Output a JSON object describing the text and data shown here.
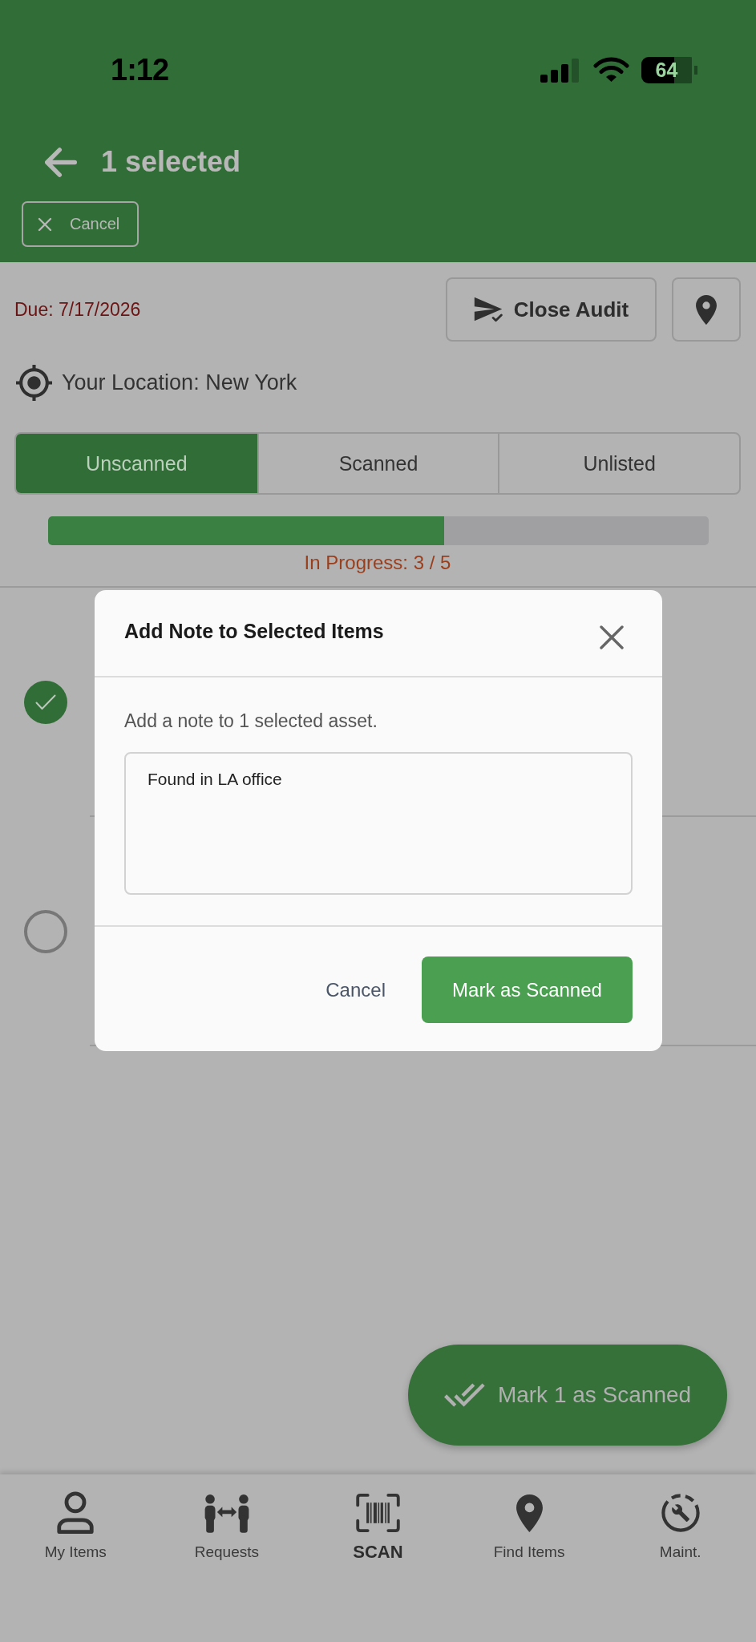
{
  "status_bar": {
    "time": "1:12",
    "battery": "64"
  },
  "header": {
    "title": "1 selected",
    "cancel_button": "Cancel"
  },
  "audit": {
    "due": "Due: 7/17/2026",
    "close_button": "Close Audit",
    "location": "Your Location: New York"
  },
  "tabs": [
    {
      "label": "Unscanned",
      "selected": true
    },
    {
      "label": "Scanned",
      "selected": false
    },
    {
      "label": "Unlisted",
      "selected": false
    }
  ],
  "progress": {
    "level": 0.6,
    "label": "In Progress: 3 / 5"
  },
  "items": [
    {
      "selected": true
    },
    {
      "selected": false
    }
  ],
  "dialog": {
    "title": "Add Note to Selected Items",
    "message": "Add a note to 1 selected asset.",
    "note": {
      "value": "Found in LA office"
    },
    "buttons": [
      {
        "label": "Cancel",
        "kind": "text"
      },
      {
        "label": "Mark as Scanned",
        "kind": "primary"
      }
    ]
  },
  "fab": {
    "label": "Mark 1 as Scanned"
  },
  "bottom_nav": [
    {
      "label": "My Items",
      "kind": "normal"
    },
    {
      "label": "Requests",
      "kind": "normal"
    },
    {
      "label": "SCAN",
      "kind": "primary"
    },
    {
      "label": "Find Items",
      "kind": "normal"
    },
    {
      "label": "Maint.",
      "kind": "normal"
    }
  ]
}
